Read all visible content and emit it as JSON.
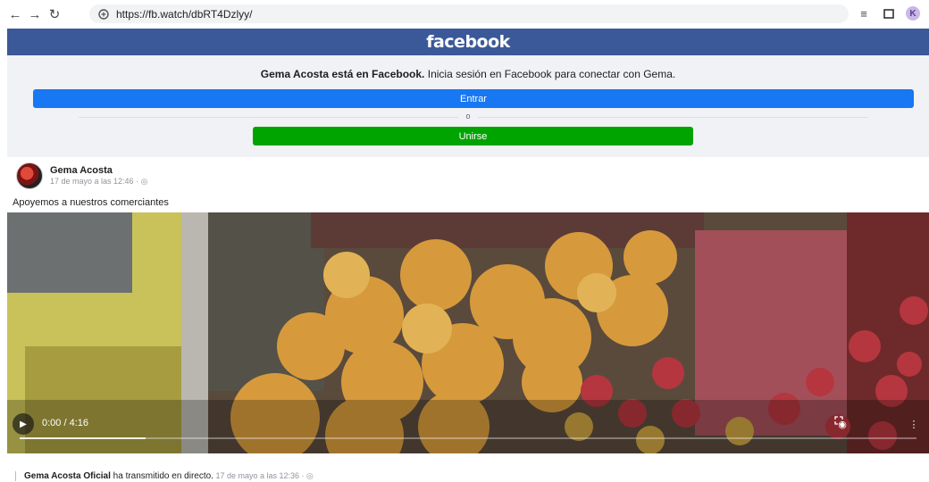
{
  "browser": {
    "url": "https://fb.watch/dbRT4Dzlyy/",
    "profile_initial": "K"
  },
  "header": {
    "logo": "facebook"
  },
  "banner": {
    "name_strong": "Gema Acosta está en Facebook.",
    "message_rest": " Inicia sesión en Facebook para conectar con Gema.",
    "login_label": "Entrar",
    "or_label": "o",
    "join_label": "Unirse"
  },
  "post": {
    "author": "Gema Acosta",
    "time": "17 de mayo a las 12:46 · ",
    "text": "Apoyemos a nuestros comerciantes"
  },
  "video": {
    "time_display": "0:00 / 4:16",
    "progress_fraction": 0.14
  },
  "shared": {
    "author": "Gema Acosta Oficial",
    "action": " ha transmitido en directo.",
    "time": " 17 de mayo a las 12:36 · "
  },
  "colors": {
    "fb_blue": "#3b5998",
    "login_blue": "#1877f2",
    "join_green": "#00a400"
  }
}
